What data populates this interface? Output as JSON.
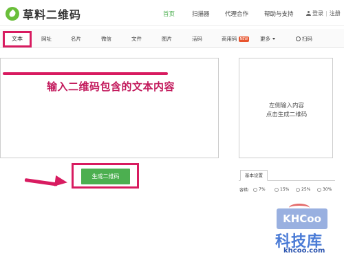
{
  "header": {
    "logo_text": "草料二维码",
    "nav": [
      "首页",
      "扫描器",
      "代理合作",
      "帮助与支持"
    ],
    "login": "登录",
    "register": "注册"
  },
  "tabs": {
    "active": "文本",
    "items": [
      "网址",
      "名片",
      "微信",
      "文件",
      "图片",
      "活码"
    ],
    "commercial": "商用码",
    "commercial_badge": "NEW",
    "more": "更多",
    "scan": "扫码"
  },
  "editor": {
    "annotation": "输入二维码包含的文本内容"
  },
  "preview": {
    "line1": "左侧输入内容",
    "line2": "点击生成二维码"
  },
  "generate_label": "生成二维码",
  "settings": {
    "tab": "基本设置",
    "fault_label": "容错:",
    "options": [
      "7%",
      "15%",
      "25%",
      "30%"
    ]
  },
  "watermark": {
    "logo": "KHCoo",
    "name": "科技库",
    "url": "khcoo.com"
  },
  "colors": {
    "brand_green": "#4caf50",
    "annotation_pink": "#d81b60"
  }
}
